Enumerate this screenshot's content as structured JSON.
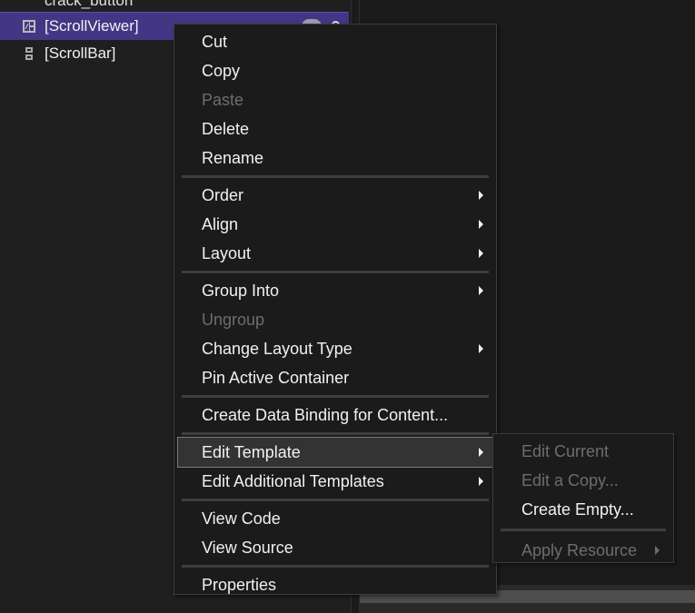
{
  "tree": {
    "rows": [
      {
        "label": "crack_button",
        "icon": "control-icon",
        "state": "partial"
      },
      {
        "label": "[ScrollViewer]",
        "icon": "scrollviewer-icon",
        "state": "selected"
      },
      {
        "label": "[ScrollBar]",
        "icon": "scrollbar-icon",
        "state": "normal"
      }
    ]
  },
  "context_menu": {
    "groups": [
      [
        {
          "label": "Cut",
          "enabled": true,
          "submenu": false
        },
        {
          "label": "Copy",
          "enabled": true,
          "submenu": false
        },
        {
          "label": "Paste",
          "enabled": false,
          "submenu": false
        },
        {
          "label": "Delete",
          "enabled": true,
          "submenu": false
        },
        {
          "label": "Rename",
          "enabled": true,
          "submenu": false
        }
      ],
      [
        {
          "label": "Order",
          "enabled": true,
          "submenu": true
        },
        {
          "label": "Align",
          "enabled": true,
          "submenu": true
        },
        {
          "label": "Layout",
          "enabled": true,
          "submenu": true
        }
      ],
      [
        {
          "label": "Group Into",
          "enabled": true,
          "submenu": true
        },
        {
          "label": "Ungroup",
          "enabled": false,
          "submenu": false
        },
        {
          "label": "Change Layout Type",
          "enabled": true,
          "submenu": true
        },
        {
          "label": "Pin Active Container",
          "enabled": true,
          "submenu": false
        }
      ],
      [
        {
          "label": "Create Data Binding for Content...",
          "enabled": true,
          "submenu": false
        }
      ],
      [
        {
          "label": "Edit Template",
          "enabled": true,
          "submenu": true,
          "highlighted": true
        },
        {
          "label": "Edit Additional Templates",
          "enabled": true,
          "submenu": true
        }
      ],
      [
        {
          "label": "View Code",
          "enabled": true,
          "submenu": false
        },
        {
          "label": "View Source",
          "enabled": true,
          "submenu": false
        }
      ],
      [
        {
          "label": "Properties",
          "enabled": true,
          "submenu": false
        }
      ]
    ]
  },
  "submenu": {
    "parent": "Edit Template",
    "groups": [
      [
        {
          "label": "Edit Current",
          "enabled": false,
          "submenu": false
        },
        {
          "label": "Edit a Copy...",
          "enabled": false,
          "submenu": false
        },
        {
          "label": "Create Empty...",
          "enabled": true,
          "submenu": false
        }
      ],
      [
        {
          "label": "Apply Resource",
          "enabled": false,
          "submenu": true
        }
      ]
    ]
  },
  "colors": {
    "selection": "#433685",
    "menu_bg": "#1b1b1b",
    "panel_bg": "#1f1f1f",
    "disabled_text": "#6d6d6d"
  }
}
